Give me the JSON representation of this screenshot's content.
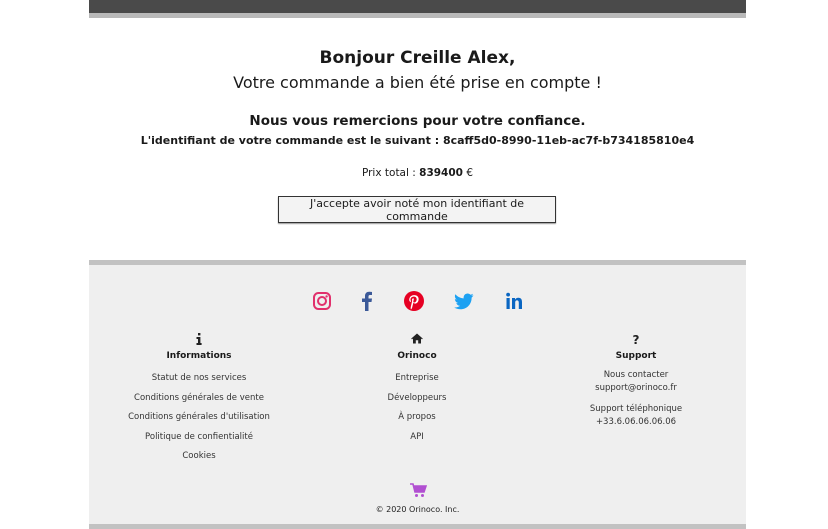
{
  "confirmation": {
    "greeting": "Bonjour Creille Alex,",
    "subtitle": "Votre commande a bien été prise en compte !",
    "thanks": "Nous vous remercions pour votre confiance.",
    "order_id_text": "L'identifiant de votre commande est le suivant : 8caff5d0-8990-11eb-ac7f-b734185810e4",
    "total_label": "Prix total :",
    "total_value": "839400",
    "currency": "€",
    "ack_button": "J'accepte avoir noté mon identifiant de commande"
  },
  "social": [
    {
      "name": "instagram",
      "color": "#e1306c"
    },
    {
      "name": "facebook",
      "color": "#3b5998"
    },
    {
      "name": "pinterest",
      "color": "#e60023"
    },
    {
      "name": "twitter",
      "color": "#1da1f2"
    },
    {
      "name": "linkedin",
      "color": "#0a66c2"
    }
  ],
  "footer": {
    "informations": {
      "icon": "info-icon",
      "title": "Informations",
      "links": [
        "Statut de nos services",
        "Conditions générales de vente",
        "Conditions générales d'utilisation",
        "Politique de confientialité",
        "Cookies"
      ]
    },
    "orinoco": {
      "icon": "home-icon",
      "title": "Orinoco",
      "links": [
        "Entreprise",
        "Développeurs",
        "À propos",
        "API"
      ]
    },
    "support": {
      "icon": "question-icon",
      "title": "Support",
      "contact_label": "Nous contacter",
      "email": "support@orinoco.fr",
      "phone_label": "Support téléphonique",
      "phone": "+33.6.06.06.06.06"
    },
    "cart_icon_color": "#b14fd1",
    "copyright": "© 2020 Orinoco. Inc."
  }
}
